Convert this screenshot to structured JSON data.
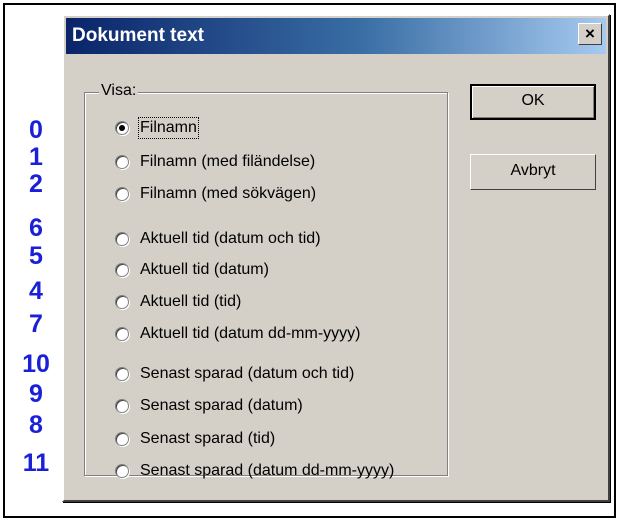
{
  "dialog": {
    "title": "Dokument text",
    "close_glyph": "×",
    "group_label": "Visa:",
    "buttons": {
      "ok": "OK",
      "cancel": "Avbryt"
    },
    "options": [
      {
        "label": "Filnamn",
        "checked": true,
        "code": "0"
      },
      {
        "label": "Filnamn (med filändelse)",
        "checked": false,
        "code": "1"
      },
      {
        "label": "Filnamn (med sökvägen)",
        "checked": false,
        "code": "2"
      },
      {
        "label": "Aktuell tid (datum och tid)",
        "checked": false,
        "code": "6"
      },
      {
        "label": "Aktuell tid (datum)",
        "checked": false,
        "code": "5"
      },
      {
        "label": "Aktuell tid (tid)",
        "checked": false,
        "code": "4"
      },
      {
        "label": "Aktuell tid (datum dd-mm-yyyy)",
        "checked": false,
        "code": "7"
      },
      {
        "label": "Senast sparad (datum och tid)",
        "checked": false,
        "code": "10"
      },
      {
        "label": "Senast sparad (datum)",
        "checked": false,
        "code": "9"
      },
      {
        "label": "Senast sparad (tid)",
        "checked": false,
        "code": "8"
      },
      {
        "label": "Senast sparad (datum dd-mm-yyyy)",
        "checked": false,
        "code": "11"
      }
    ]
  },
  "colors": {
    "annotation_number": "#1a20d8",
    "titlebar_start": "#0a246a",
    "titlebar_end": "#a6caf0",
    "dialog_face": "#d4d0c8"
  }
}
